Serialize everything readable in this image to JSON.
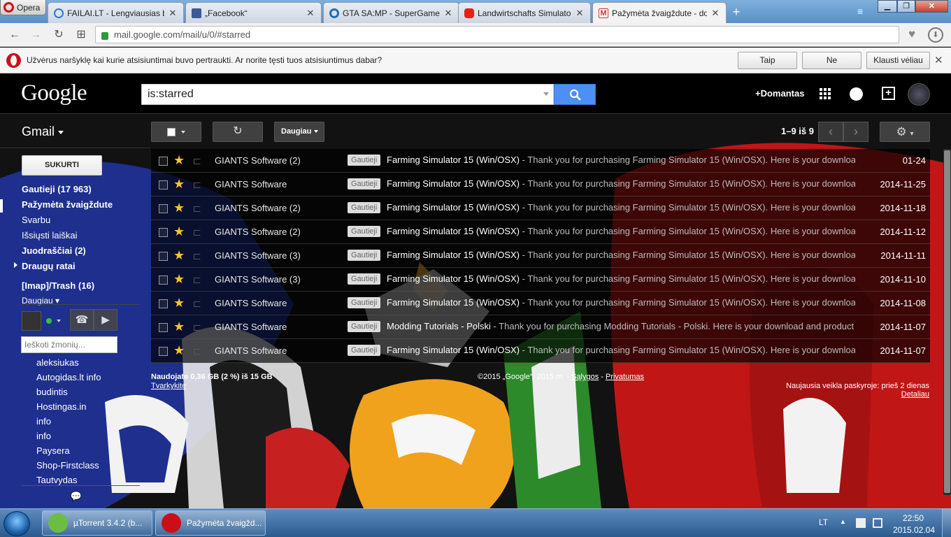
{
  "browser": {
    "menu_label": "Opera",
    "tabs": [
      {
        "title": "FAILAI.LT - Lengviausias b",
        "favicon_color": "#2a7ad6"
      },
      {
        "title": "„Facebook“",
        "favicon_color": "#3b5998"
      },
      {
        "title": "GTA SA:MP - SuperGames",
        "favicon_color": "#1a6fb7"
      },
      {
        "title": "Landwirtschafts Simulator",
        "favicon_color": "#e62117"
      },
      {
        "title": "Pažymėta žvaigždute - do",
        "favicon_color": "#d93025"
      }
    ],
    "close_glyph": "✕",
    "new_tab_glyph": "+",
    "tab_menu_glyph": "≡",
    "window_buttons": {
      "minimize": "▁",
      "maximize": "❐",
      "close": "✕"
    },
    "url": "mail.google.com/mail/u/0/#starred",
    "nav": {
      "back": "←",
      "forward": "→",
      "reload": "↻",
      "speeddial": "⊞"
    },
    "bookmark_glyph": "♥",
    "download_glyph": "⬇"
  },
  "notification": {
    "message": "Užvėrus naršyklę kai kurie atsisiuntimai buvo pertraukti. Ar norite tęsti tuos atsisiuntimus dabar?",
    "buttons": [
      "Taip",
      "Ne",
      "Klausti vėliau"
    ],
    "close_glyph": "✕"
  },
  "gmail": {
    "logo": "Google",
    "search_value": "is:starred",
    "search_icon": "search-icon",
    "user": "+Domantas",
    "share_glyph": "+",
    "app_label": "Gmail",
    "toolbar": {
      "more": "Daugiau",
      "refresh_glyph": "↻",
      "settings_glyph": "⚙"
    },
    "pager": {
      "text": "1–9 iš 9",
      "prev": "‹",
      "next": "›"
    },
    "compose": "SUKURTI",
    "labels": [
      {
        "text": "Gautieji (17 963)",
        "bold": true
      },
      {
        "text": "Pažymėta žvaigždute",
        "bold": true
      },
      {
        "text": "Svarbu",
        "bold": false
      },
      {
        "text": "Išsiųsti laiškai",
        "bold": false
      },
      {
        "text": "Juodraščiai (2)",
        "bold": true
      },
      {
        "text": "Draugų ratai",
        "bold": true
      },
      {
        "text": "[Imap]/Trash (16)",
        "bold": true
      },
      {
        "text": "Daugiau ▾",
        "bold": false
      }
    ],
    "people_search_placeholder": "Ieškoti žmonių...",
    "contacts": [
      "aleksiukas",
      "Autogidas.lt info",
      "budintis",
      "Hostingas.in",
      "info",
      "info",
      "Paysera",
      "Shop-Firstclass",
      "Tautvydas"
    ],
    "hangout_buttons": {
      "phone": "☎",
      "video": "▶"
    },
    "chat_glyph": "💬",
    "messages": [
      {
        "sender": "GIANTS Software (2)",
        "label": "Gautieji",
        "subject": "Farming Simulator 15 (Win/OSX)",
        "snippet": " - Thank you for purchasing Farming Simulator 15 (Win/OSX). Here is your download",
        "date": "01-24"
      },
      {
        "sender": "GIANTS Software",
        "label": "Gautieji",
        "subject": "Farming Simulator 15 (Win/OSX)",
        "snippet": " - Thank you for purchasing Farming Simulator 15 (Win/OSX). Here is your download",
        "date": "2014-11-25"
      },
      {
        "sender": "GIANTS Software (2)",
        "label": "Gautieji",
        "subject": "Farming Simulator 15 (Win/OSX)",
        "snippet": " - Thank you for purchasing Farming Simulator 15 (Win/OSX). Here is your download",
        "date": "2014-11-18"
      },
      {
        "sender": "GIANTS Software (2)",
        "label": "Gautieji",
        "subject": "Farming Simulator 15 (Win/OSX)",
        "snippet": " - Thank you for purchasing Farming Simulator 15 (Win/OSX). Here is your download",
        "date": "2014-11-12"
      },
      {
        "sender": "GIANTS Software (3)",
        "label": "Gautieji",
        "subject": "Farming Simulator 15 (Win/OSX)",
        "snippet": " - Thank you for purchasing Farming Simulator 15 (Win/OSX). Here is your download",
        "date": "2014-11-11"
      },
      {
        "sender": "GIANTS Software (3)",
        "label": "Gautieji",
        "subject": "Farming Simulator 15 (Win/OSX)",
        "snippet": " - Thank you for purchasing Farming Simulator 15 (Win/OSX). Here is your download",
        "date": "2014-11-10"
      },
      {
        "sender": "GIANTS Software",
        "label": "Gautieji",
        "subject": "Farming Simulator 15 (Win/OSX)",
        "snippet": " - Thank you for purchasing Farming Simulator 15 (Win/OSX). Here is your download",
        "date": "2014-11-08"
      },
      {
        "sender": "GIANTS Software",
        "label": "Gautieji",
        "subject": "Modding Tutorials - Polski",
        "snippet": " - Thank you for purchasing Modding Tutorials - Polski. Here is your download and product k",
        "date": "2014-11-07"
      },
      {
        "sender": "GIANTS Software",
        "label": "Gautieji",
        "subject": "Farming Simulator 15 (Win/OSX)",
        "snippet": " - Thank you for purchasing Farming Simulator 15 (Win/OSX). Here is your download",
        "date": "2014-11-07"
      }
    ],
    "star_glyph": "★",
    "footer": {
      "usage": "Naudojate 0,36 GB (2 %) iš 15 GB",
      "manage": "Tvarkykite",
      "copyright_prefix": "©2015 „Google“, 2015 m. - ",
      "terms": "Sąlygos",
      "sep": " - ",
      "privacy": "Privatumas",
      "activity": "Naujausia veikla paskyroje: prieš 2 dienas",
      "details": "Detaliau"
    }
  },
  "taskbar": {
    "items": [
      {
        "title": "µTorrent 3.4.2  (b...",
        "icon_color": "#6cbd45"
      },
      {
        "title": "Pažymėta žvaigžd...",
        "icon_color": "#cc0f16"
      }
    ],
    "lang": "LT",
    "tray_up": "▲",
    "time": "22:50",
    "date": "2015.02.04"
  },
  "colors": {
    "accent_blue": "#4d8ff2",
    "star": "#f7c32a",
    "opera_red": "#cc0f16"
  }
}
